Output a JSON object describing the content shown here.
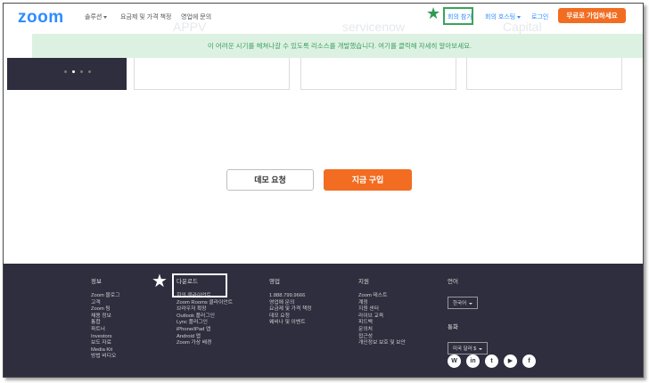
{
  "header": {
    "logo": "zoom",
    "nav_left": [
      {
        "label": "솔루션",
        "has_caret": true
      },
      {
        "label": "요금제 및 가격 책정",
        "has_caret": false
      },
      {
        "label": "영업에 문의",
        "has_caret": false
      }
    ],
    "join_meeting": "회의 참가",
    "host_meeting": "회의 호스팅",
    "sign_in": "로그인",
    "sign_up": "무료로 가입하세요",
    "accent_color": "#f26d21",
    "brand_color": "#2d8cff"
  },
  "banner": {
    "text": "이 어려운 시기를 헤쳐나갈 수 있도록 리소스를 개발했습니다. 여기를 클릭해 자세히 알아보세요."
  },
  "actions": {
    "demo": "데모 요청",
    "buy": "지금 구입"
  },
  "footer": {
    "about": {
      "heading": "정보",
      "links": [
        "Zoom 블로그",
        "고객",
        "Zoom 팀",
        "채용 정보",
        "통합",
        "파트너",
        "Investors",
        "보도 자료",
        "Media Kit",
        "방법 비디오"
      ]
    },
    "download": {
      "heading": "다운로드",
      "links": [
        "회의 클라이언트",
        "Zoom Rooms 클라이언트",
        "브라우저 확장",
        "Outlook 플러그인",
        "Lync 플러그인",
        "iPhone/iPad 앱",
        "Android 앱",
        "Zoom 가상 배경"
      ]
    },
    "sales": {
      "heading": "영업",
      "links": [
        "1.888.799.9666",
        "영업에 문의",
        "요금제 및 가격 책정",
        "데모 요청",
        "웨비나 및 이벤트"
      ]
    },
    "support": {
      "heading": "지원",
      "links": [
        "Zoom 테스트",
        "계정",
        "지원 센터",
        "라이브 교육",
        "피드백",
        "문의처",
        "접근성",
        "개인정보 보호 및 보안"
      ]
    },
    "language": {
      "heading": "언어",
      "selected": "한국어"
    },
    "currency": {
      "heading": "통화",
      "selected": "미국 달러 $"
    },
    "socials": [
      {
        "name": "wordpress-icon",
        "glyph": "W"
      },
      {
        "name": "linkedin-icon",
        "glyph": "in"
      },
      {
        "name": "twitter-icon",
        "glyph": "t"
      },
      {
        "name": "youtube-icon",
        "glyph": "▶"
      },
      {
        "name": "facebook-icon",
        "glyph": "f"
      }
    ]
  }
}
